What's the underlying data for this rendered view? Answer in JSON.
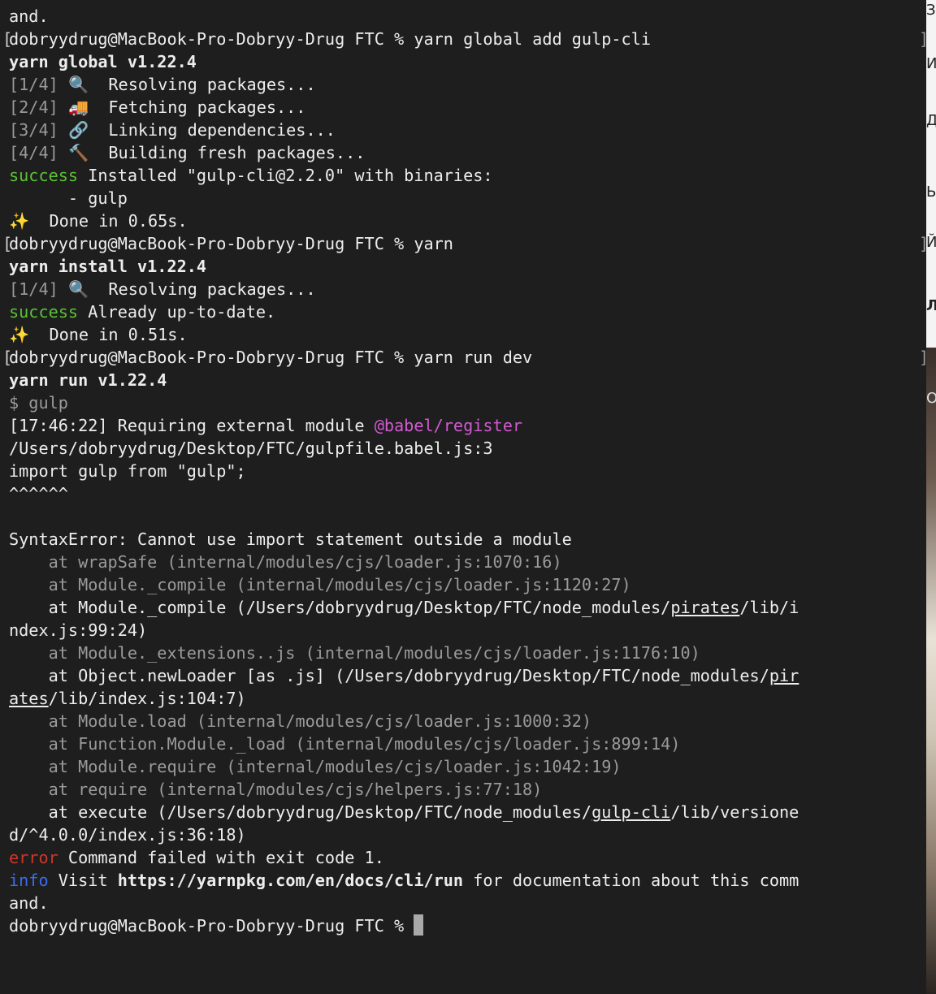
{
  "terminal": {
    "lines": [
      {
        "type": "plain",
        "text": "and."
      },
      {
        "type": "prompt",
        "prompt": "dobryydrug@MacBook-Pro-Dobryy-Drug FTC % ",
        "command": "yarn global add gulp-cli",
        "bracket_left": "[",
        "bracket_right": "]"
      },
      {
        "type": "bold",
        "text": "yarn global v1.22.4"
      },
      {
        "type": "step",
        "step": "[1/4]",
        "icon": "🔍",
        "text": "  Resolving packages..."
      },
      {
        "type": "step",
        "step": "[2/4]",
        "icon": "🚚",
        "text": "  Fetching packages..."
      },
      {
        "type": "step",
        "step": "[3/4]",
        "icon": "🔗",
        "text": "  Linking dependencies..."
      },
      {
        "type": "step",
        "step": "[4/4]",
        "icon": "🔨",
        "text": "  Building fresh packages..."
      },
      {
        "type": "status",
        "tag": "success",
        "text": " Installed \"gulp-cli@2.2.0\" with binaries:"
      },
      {
        "type": "plain",
        "text": "      - gulp"
      },
      {
        "type": "done",
        "icon": "✨",
        "text": "  Done in 0.65s."
      },
      {
        "type": "prompt",
        "prompt": "dobryydrug@MacBook-Pro-Dobryy-Drug FTC % ",
        "command": "yarn",
        "bracket_left": "[",
        "bracket_right": "]"
      },
      {
        "type": "bold",
        "text": "yarn install v1.22.4"
      },
      {
        "type": "step",
        "step": "[1/4]",
        "icon": "🔍",
        "text": "  Resolving packages..."
      },
      {
        "type": "status",
        "tag": "success",
        "text": " Already up-to-date."
      },
      {
        "type": "done",
        "icon": "✨",
        "text": "  Done in 0.51s."
      },
      {
        "type": "prompt",
        "prompt": "dobryydrug@MacBook-Pro-Dobryy-Drug FTC % ",
        "command": "yarn run dev",
        "bracket_left": "[",
        "bracket_right": "]"
      },
      {
        "type": "bold",
        "text": "yarn run v1.22.4"
      },
      {
        "type": "dim",
        "text": "$ gulp"
      },
      {
        "type": "require",
        "time": "[17:46:22]",
        "text": " Requiring external module ",
        "module": "@babel/register"
      },
      {
        "type": "plain",
        "text": "/Users/dobryydrug/Desktop/FTC/gulpfile.babel.js:3"
      },
      {
        "type": "plain",
        "text": "import gulp from \"gulp\";"
      },
      {
        "type": "plain",
        "text": "^^^^^^"
      },
      {
        "type": "plain",
        "text": ""
      },
      {
        "type": "plain",
        "text": "SyntaxError: Cannot use import statement outside a module"
      },
      {
        "type": "dim",
        "text": "    at wrapSafe (internal/modules/cjs/loader.js:1070:16)"
      },
      {
        "type": "dim",
        "text": "    at Module._compile (internal/modules/cjs/loader.js:1120:27)"
      },
      {
        "type": "linked",
        "before": "    at Module._compile (/Users/dobryydrug/Desktop/FTC/node_modules/",
        "link": "pirates",
        "after": "/lib/i"
      },
      {
        "type": "plain",
        "text": "ndex.js:99:24)"
      },
      {
        "type": "dim",
        "text": "    at Module._extensions..js (internal/modules/cjs/loader.js:1176:10)"
      },
      {
        "type": "linked",
        "before": "    at Object.newLoader [as .js] (/Users/dobryydrug/Desktop/FTC/node_modules/",
        "link": "pir",
        "after": ""
      },
      {
        "type": "linked",
        "before": "",
        "link": "ates",
        "after": "/lib/index.js:104:7)"
      },
      {
        "type": "dim",
        "text": "    at Module.load (internal/modules/cjs/loader.js:1000:32)"
      },
      {
        "type": "dim",
        "text": "    at Function.Module._load (internal/modules/cjs/loader.js:899:14)"
      },
      {
        "type": "dim",
        "text": "    at Module.require (internal/modules/cjs/loader.js:1042:19)"
      },
      {
        "type": "dim",
        "text": "    at require (internal/modules/cjs/helpers.js:77:18)"
      },
      {
        "type": "linked",
        "before": "    at execute (/Users/dobryydrug/Desktop/FTC/node_modules/",
        "link": "gulp-cli",
        "after": "/lib/versione"
      },
      {
        "type": "plain",
        "text": "d/^4.0.0/index.js:36:18)"
      },
      {
        "type": "status",
        "tag": "error",
        "text": " Command failed with exit code 1."
      },
      {
        "type": "info",
        "tag": "info",
        "text_before": " Visit ",
        "url": "https://yarnpkg.com/en/docs/cli/run",
        "text_after": " for documentation about this comm"
      },
      {
        "type": "plain",
        "text": "and."
      },
      {
        "type": "cursor",
        "prompt": "dobryydrug@MacBook-Pro-Dobryy-Drug FTC % "
      }
    ]
  },
  "right_panel": {
    "glyphs": [
      "ЗД",
      "И",
      "Д",
      "ЬН",
      "Й",
      "Л",
      "ОС"
    ]
  },
  "colors": {
    "background": "#1e1e1e",
    "text": "#ededed",
    "dim": "#9a9a9a",
    "success": "#5bc236",
    "error": "#d1362a",
    "info": "#3b6cf0",
    "module": "#d15ad1",
    "cursor": "#a9a9a9"
  }
}
